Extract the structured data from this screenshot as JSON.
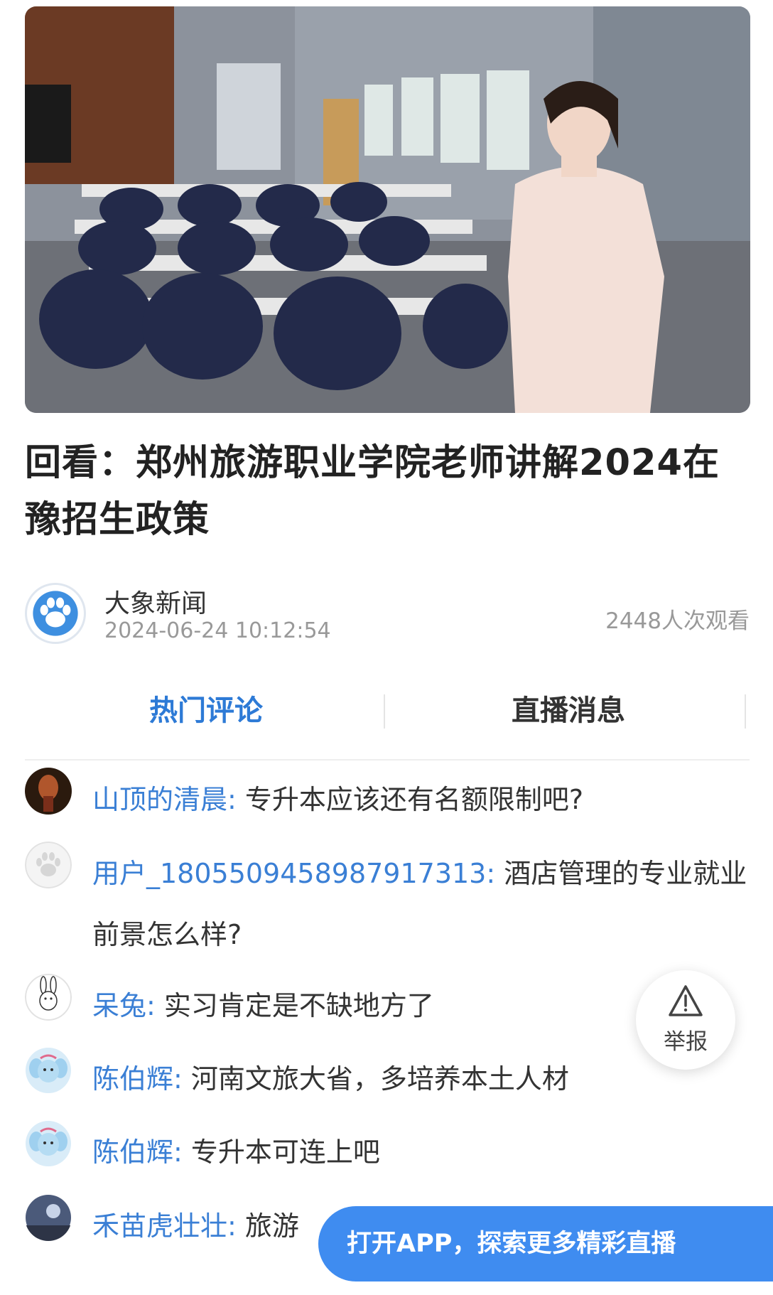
{
  "video": {
    "thumbnail_icon": "video-thumbnail"
  },
  "title": "回看：郑州旅游职业学院老师讲解2024在豫招生政策",
  "author": {
    "name": "大象新闻",
    "time": "2024-06-24 10:12:54",
    "views": "2448人次观看",
    "avatar_icon": "paw-logo-icon"
  },
  "tabs": [
    {
      "label": "热门评论",
      "active": true
    },
    {
      "label": "直播消息",
      "active": false
    }
  ],
  "comments": [
    {
      "user": "山顶的清晨:",
      "text": "专升本应该还有名额限制吧?"
    },
    {
      "user": "用户_1805509458987917313:",
      "text": "酒店管理的专业就业前景怎么样?"
    },
    {
      "user": "呆兔:",
      "text": "实习肯定是不缺地方了"
    },
    {
      "user": "陈伯辉:",
      "text": "河南文旅大省，多培养本土人材"
    },
    {
      "user": "陈伯辉:",
      "text": "专升本可连上吧"
    },
    {
      "user": "禾苗虎壮壮:",
      "text": "旅游"
    }
  ],
  "report": {
    "label": "举报",
    "icon": "warning-icon"
  },
  "open_app": {
    "label": "打开APP，探索更多精彩直播"
  },
  "colors": {
    "accent": "#2d7ad6",
    "username": "#3a7fd5",
    "app_button": "#3f8cf0"
  }
}
